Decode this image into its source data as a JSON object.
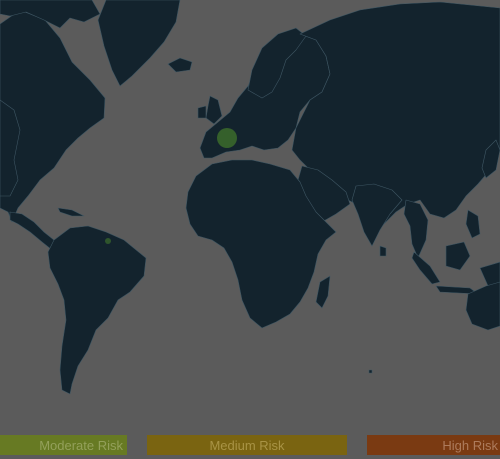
{
  "map": {
    "background_color": "#5b5b5b",
    "land_color": "#13232d",
    "border_color": "#3e5663",
    "marker_color": "#3c6b2c"
  },
  "markers": [
    {
      "name": "france-risk-marker",
      "region": "France"
    },
    {
      "name": "guyana-risk-marker",
      "region": "Northern South America"
    }
  ],
  "legend": [
    {
      "id": "moderate",
      "label": "Moderate Risk",
      "color": "#677a23",
      "text_color": "#93a05a"
    },
    {
      "id": "medium",
      "label": "Medium Risk",
      "color": "#7a6411",
      "text_color": "#a89345"
    },
    {
      "id": "high",
      "label": "High Risk",
      "color": "#7a3a12",
      "text_color": "#ad7b5c"
    }
  ]
}
